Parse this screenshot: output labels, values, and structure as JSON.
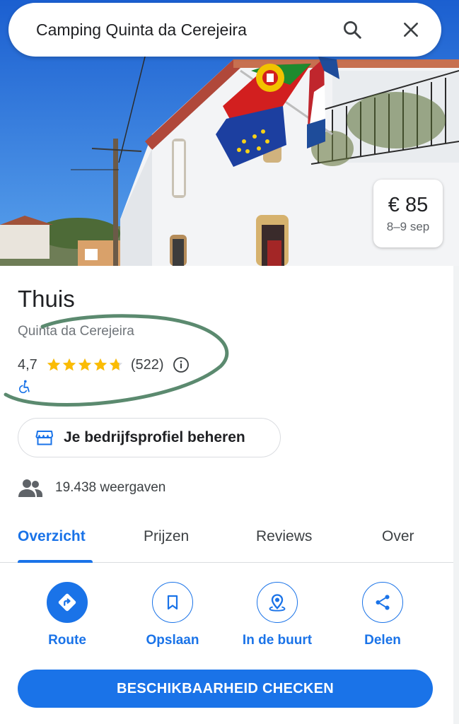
{
  "search": {
    "query": "Camping Quinta da Cerejeira"
  },
  "icons": {
    "search": "search-icon",
    "close": "close-icon",
    "info": "info-icon",
    "accessibility": "wheelchair-icon",
    "business": "storefront-icon",
    "views": "people-icon",
    "route": "directions-icon",
    "save": "bookmark-icon",
    "nearby": "nearby-pin-icon",
    "share": "share-icon"
  },
  "colors": {
    "accent": "#1a73e8",
    "star": "#fbbc04",
    "annotation": "#5b8a6f"
  },
  "hero": {
    "price": "€ 85",
    "dates": "8–9 sep"
  },
  "place": {
    "title": "Thuis",
    "subtitle": "Quinta da Cerejeira",
    "rating": "4,7",
    "rating_value": 4.7,
    "review_count": "(522)"
  },
  "business_profile": {
    "label": "Je bedrijfsprofiel beheren"
  },
  "views": {
    "label": "19.438 weergaven"
  },
  "tabs": [
    {
      "label": "Overzicht",
      "active": true
    },
    {
      "label": "Prijzen",
      "active": false
    },
    {
      "label": "Reviews",
      "active": false
    },
    {
      "label": "Over",
      "active": false
    }
  ],
  "actions": [
    {
      "label": "Route",
      "icon": "directions-icon"
    },
    {
      "label": "Opslaan",
      "icon": "bookmark-icon"
    },
    {
      "label": "In de buurt",
      "icon": "nearby-pin-icon"
    },
    {
      "label": "Delen",
      "icon": "share-icon"
    }
  ],
  "cta": {
    "label": "BESCHIKBAARHEID CHECKEN"
  }
}
